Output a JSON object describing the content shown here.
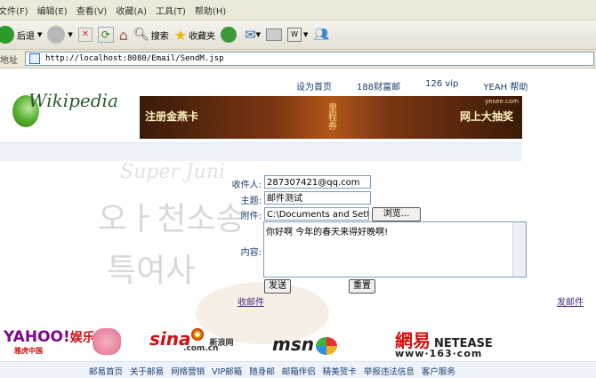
{
  "browser": {
    "menu": [
      "文件(F)",
      "编辑(E)",
      "查看(V)",
      "收藏(A)",
      "工具(T)",
      "帮助(H)"
    ],
    "toolbar": {
      "back": "后退",
      "search": "搜索",
      "favorites": "收藏夹"
    },
    "address_label": "地址",
    "address_url": "http://localhost:8080/Email/SendM.jsp"
  },
  "top_links": [
    "设为首页",
    "188财富邮",
    "126 vip",
    "YEAH 帮助"
  ],
  "logo_text": "Wikipedia",
  "banner": {
    "left": "注册金燕卡",
    "center": "里程券",
    "right": "网上大抽奖",
    "site": "yesee.com"
  },
  "background_text": "Super Juni",
  "form": {
    "to_label": "收件人:",
    "to_value": "287307421@qq.com",
    "subject_label": "主题:",
    "subject_value": "邮件测试",
    "attach_label": "附件:",
    "attach_value": "C:\\Documents and Sett",
    "browse_label": "浏览...",
    "content_label": "内容:",
    "content_value": "你好啊 今年的春天来得好晚啊!",
    "send_label": "发送",
    "reset_label": "重置"
  },
  "inbox_link": "收邮件",
  "send_link": "发邮件",
  "partners": {
    "yahoo": "YAHOO!",
    "yahoo_cn": "娱乐",
    "yahoo_sub": "雅虎中国",
    "sina": "sina",
    "sina_cn": "新浪网",
    "sina_dom": ".com.cn",
    "msn": "msn",
    "netease_cn": "網易",
    "netease_en": "NETEASE",
    "netease_www": "www·163·com"
  },
  "footer_links": [
    "邮易首页",
    "关于邮易",
    "网络营销",
    "VIP邮箱",
    "随身邮",
    "邮箱伴侣",
    "精美贺卡",
    "举报违法信息",
    "客户服务"
  ]
}
